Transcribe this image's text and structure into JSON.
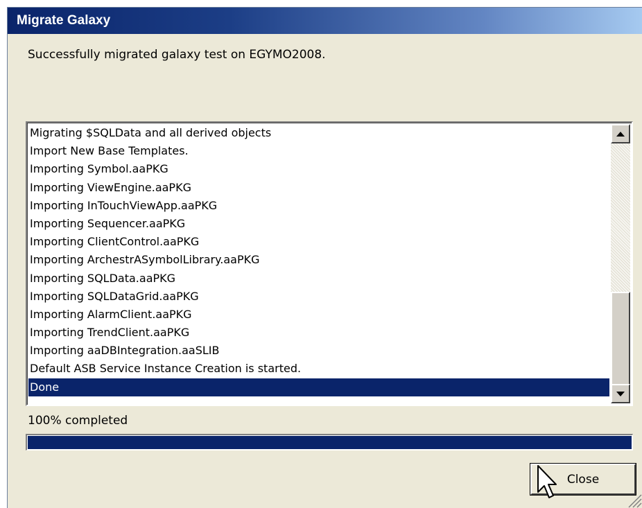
{
  "window": {
    "title": "Migrate Galaxy"
  },
  "message": "Successfully migrated galaxy test on EGYMO2008.",
  "log": {
    "items": [
      "Migrating $SQLData and all derived objects",
      "Import New Base Templates.",
      "Importing Symbol.aaPKG",
      "Importing ViewEngine.aaPKG",
      "Importing InTouchViewApp.aaPKG",
      "Importing Sequencer.aaPKG",
      "Importing ClientControl.aaPKG",
      "Importing ArchestrASymbolLibrary.aaPKG",
      "Importing SQLData.aaPKG",
      "Importing SQLDataGrid.aaPKG",
      "Importing AlarmClient.aaPKG",
      "Importing TrendClient.aaPKG",
      "Importing aaDBIntegration.aaSLIB",
      "Default ASB Service Instance Creation is started.",
      "Done"
    ],
    "selected_index": 14
  },
  "progress": {
    "label": "100% completed",
    "value": 1.0
  },
  "buttons": {
    "close_label": "Close"
  },
  "icons": {
    "scroll_up": "arrow-up-icon",
    "scroll_down": "arrow-down-icon",
    "cursor": "mouse-pointer-icon",
    "grip": "resize-grip-icon"
  },
  "colors": {
    "title_gradient_start": "#0a246a",
    "title_gradient_end": "#a6caf0",
    "selection": "#0a246a",
    "progress_fill": "#0a246a",
    "dialog_bg": "#ece9d8"
  }
}
